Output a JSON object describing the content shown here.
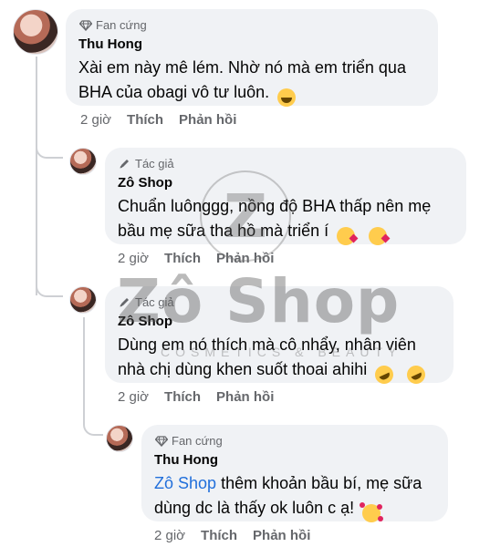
{
  "comments": [
    {
      "badge": "Fan cứng",
      "badge_icon": "diamond-icon",
      "author": "Thu Hong",
      "text": "Xài em này mê lém. Nhờ nó mà em triển qua BHA của obagi vô tư luôn.",
      "emojis": [
        "😆"
      ],
      "time": "2 giờ",
      "like": "Thích",
      "reply": "Phản hồi"
    },
    {
      "badge": "Tác giả",
      "badge_icon": "pencil-icon",
      "author": "Zô Shop",
      "text": "Chuẩn luônggg, nồng độ BHA thấp nên mẹ bầu mẹ sữa tha hồ mà triển í",
      "emojis": [
        "😘",
        "😘"
      ],
      "time": "2 giờ",
      "like": "Thích",
      "reply": "Phản hồi"
    },
    {
      "badge": "Tác giả",
      "badge_icon": "pencil-icon",
      "author": "Zô Shop",
      "text": "Dùng em nó thích mà cô nhẩy, nhân viên nhà chị dùng khen suốt thoai ahihi",
      "emojis": [
        "🤣",
        "🤣"
      ],
      "time": "2 giờ",
      "like": "Thích",
      "reply": "Phản hồi"
    },
    {
      "badge": "Fan cứng",
      "badge_icon": "diamond-icon",
      "author": "Thu Hong",
      "mention": "Zô Shop",
      "text": "thêm khoản bầu bí, mẹ sữa dùng dc là thấy ok luôn c ạ!",
      "emojis": [
        "🥰"
      ],
      "time": "2 giờ",
      "like": "Thích",
      "reply": "Phản hồi"
    }
  ],
  "watermark": {
    "logo_letter": "Z",
    "title": "Zô Shop",
    "subtitle": "COSMETICS & BEAUTY"
  },
  "colors": {
    "bubble": "#f0f2f5",
    "meta": "#65676b",
    "mention": "#216fdb",
    "thread_line": "#ced0d4"
  }
}
